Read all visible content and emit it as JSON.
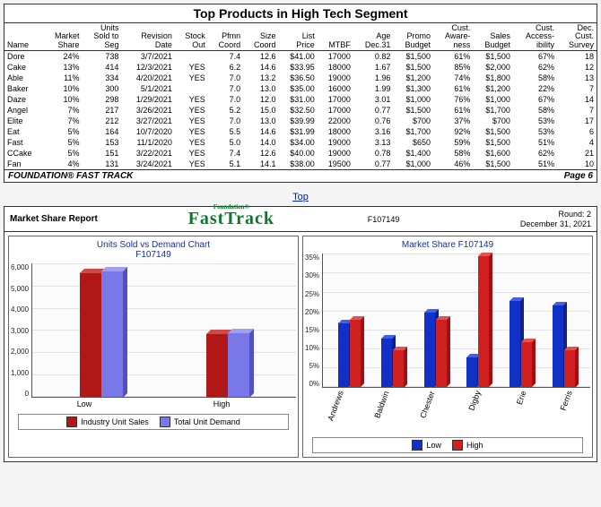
{
  "top_table": {
    "title": "Top Products in High Tech Segment",
    "headers": [
      "Name",
      "Market\nShare",
      "Units\nSold to\nSeg",
      "Revision\nDate",
      "Stock\nOut",
      "Pfmn\nCoord",
      "Size\nCoord",
      "List\nPrice",
      "MTBF",
      "Age\nDec.31",
      "Promo\nBudget",
      "Cust.\nAware-\nness",
      "Sales\nBudget",
      "Cust.\nAccess-\nibility",
      "Dec.\nCust.\nSurvey"
    ],
    "rows": [
      [
        "Dore",
        "24%",
        "738",
        "3/7/2021",
        "",
        "7.4",
        "12.6",
        "$41.00",
        "17000",
        "0.82",
        "$1,500",
        "61%",
        "$1,500",
        "67%",
        "18"
      ],
      [
        "Cake",
        "13%",
        "414",
        "12/3/2021",
        "YES",
        "6.2",
        "14.6",
        "$33.95",
        "18000",
        "1.67",
        "$1,500",
        "85%",
        "$2,000",
        "62%",
        "12"
      ],
      [
        "Able",
        "11%",
        "334",
        "4/20/2021",
        "YES",
        "7.0",
        "13.2",
        "$36.50",
        "19000",
        "1.96",
        "$1,200",
        "74%",
        "$1,800",
        "58%",
        "13"
      ],
      [
        "Baker",
        "10%",
        "300",
        "5/1/2021",
        "",
        "7.0",
        "13.0",
        "$35.00",
        "16000",
        "1.99",
        "$1,300",
        "61%",
        "$1,200",
        "22%",
        "7"
      ],
      [
        "Daze",
        "10%",
        "298",
        "1/29/2021",
        "YES",
        "7.0",
        "12.0",
        "$31.00",
        "17000",
        "3.01",
        "$1,000",
        "76%",
        "$1,000",
        "67%",
        "14"
      ],
      [
        "Angel",
        "7%",
        "217",
        "3/26/2021",
        "YES",
        "5.2",
        "15.0",
        "$32.50",
        "17000",
        "0.77",
        "$1,500",
        "61%",
        "$1,700",
        "58%",
        "7"
      ],
      [
        "Elite",
        "7%",
        "212",
        "3/27/2021",
        "YES",
        "7.0",
        "13.0",
        "$39.99",
        "22000",
        "0.76",
        "$700",
        "37%",
        "$700",
        "53%",
        "17"
      ],
      [
        "Eat",
        "5%",
        "164",
        "10/7/2020",
        "YES",
        "5.5",
        "14.6",
        "$31.99",
        "18000",
        "3.16",
        "$1,700",
        "92%",
        "$1,500",
        "53%",
        "6"
      ],
      [
        "Fast",
        "5%",
        "153",
        "11/1/2020",
        "YES",
        "5.0",
        "14.0",
        "$34.00",
        "19000",
        "3.13",
        "$650",
        "59%",
        "$1,500",
        "51%",
        "4"
      ],
      [
        "CCake",
        "5%",
        "151",
        "3/22/2021",
        "YES",
        "7.4",
        "12.6",
        "$40.00",
        "19000",
        "0.78",
        "$1,400",
        "58%",
        "$1,600",
        "62%",
        "21"
      ],
      [
        "Fan",
        "4%",
        "131",
        "3/24/2021",
        "YES",
        "5.1",
        "14.1",
        "$38.00",
        "19500",
        "0.77",
        "$1,000",
        "46%",
        "$1,500",
        "51%",
        "10"
      ]
    ],
    "footer_left": "FOUNDATION® FAST TRACK",
    "footer_right": "Page 6"
  },
  "top_link": "Top",
  "report": {
    "title": "Market Share Report",
    "logo_small": "Foundation®",
    "logo": "FastTrack",
    "id": "F107149",
    "round": "Round: 2",
    "date": "December 31, 2021"
  },
  "chart1": {
    "title_line1": "Units Sold vs Demand Chart",
    "title_line2": "F107149",
    "legend": [
      "Industry Unit Sales",
      "Total Unit Demand"
    ]
  },
  "chart2": {
    "title": "Market Share  F107149",
    "legend": [
      "Low",
      "High"
    ]
  },
  "chart_data": [
    {
      "type": "bar",
      "title": "Units Sold vs Demand Chart F107149",
      "categories": [
        "Low",
        "High"
      ],
      "series": [
        {
          "name": "Industry Unit Sales",
          "values": [
            6000,
            3050
          ]
        },
        {
          "name": "Total Unit Demand",
          "values": [
            6100,
            3100
          ]
        }
      ],
      "ylim": [
        0,
        6500
      ],
      "y_ticks": [
        0,
        1000,
        2000,
        3000,
        4000,
        5000,
        6000
      ],
      "xlabel": "",
      "ylabel": ""
    },
    {
      "type": "bar",
      "title": "Market Share F107149",
      "categories": [
        "Andrews",
        "Baldwin",
        "Chester",
        "Digby",
        "Erie",
        "Ferris"
      ],
      "series": [
        {
          "name": "Low",
          "values": [
            17,
            13,
            20,
            8,
            23,
            22
          ]
        },
        {
          "name": "High",
          "values": [
            18,
            10,
            18,
            35,
            12,
            10
          ]
        }
      ],
      "ylim": [
        0,
        36
      ],
      "y_ticks": [
        "0%",
        "5%",
        "10%",
        "15%",
        "20%",
        "25%",
        "30%",
        "35%"
      ],
      "xlabel": "",
      "ylabel": ""
    }
  ]
}
